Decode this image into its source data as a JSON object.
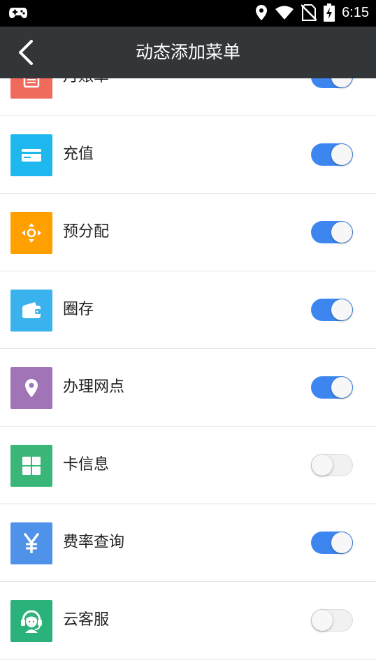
{
  "status_bar": {
    "time": "6:15",
    "icons": [
      "gamepad-icon",
      "location-icon",
      "wifi-icon",
      "no-sim-icon",
      "battery-charging-icon"
    ]
  },
  "header": {
    "back_icon": "chevron-left-icon",
    "title": "动态添加菜单"
  },
  "menu_items": [
    {
      "label": "月账单",
      "icon": "bill-icon",
      "icon_color": "#f16b5c",
      "enabled": true
    },
    {
      "label": "充值",
      "icon": "card-icon",
      "icon_color": "#1fb8ee",
      "enabled": true
    },
    {
      "label": "预分配",
      "icon": "arrows-move-icon",
      "icon_color": "#ffa000",
      "enabled": true
    },
    {
      "label": "圈存",
      "icon": "wallet-icon",
      "icon_color": "#3ab2ed",
      "enabled": true
    },
    {
      "label": "办理网点",
      "icon": "map-pin-icon",
      "icon_color": "#a173b7",
      "enabled": true
    },
    {
      "label": "卡信息",
      "icon": "grid-icon",
      "icon_color": "#3ab778",
      "enabled": false
    },
    {
      "label": "费率查询",
      "icon": "yen-icon",
      "icon_color": "#4f92ea",
      "enabled": true
    },
    {
      "label": "云客服",
      "icon": "headset-icon",
      "icon_color": "#2bb27a",
      "enabled": false
    }
  ],
  "colors": {
    "toggle_on": "#3d86f0",
    "toggle_off": "#f1f1f1",
    "nav_bar": "#333638",
    "status_bar": "#000000"
  }
}
